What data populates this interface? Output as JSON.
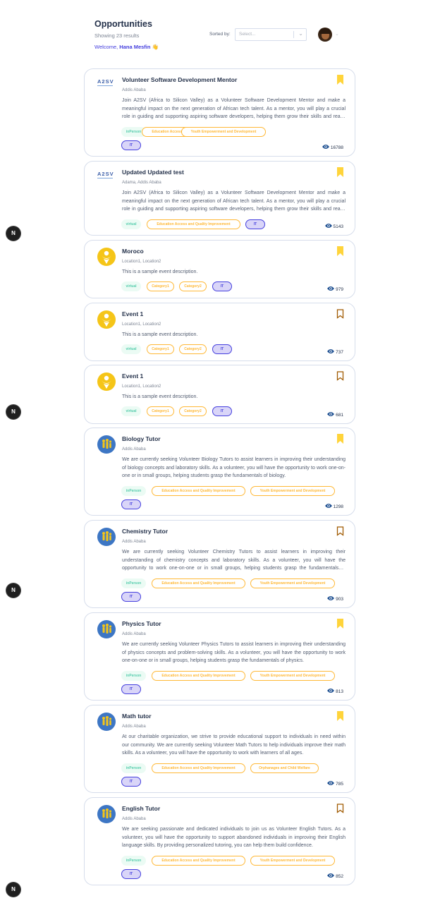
{
  "header": {
    "title": "Opportunities",
    "count": "Showing 23 results",
    "welcome_prefix": "Welcome, ",
    "user_name": "Hana Mesfin",
    "wave": "👋",
    "sort_label": "Sorted by:",
    "sort_placeholder": "Select..."
  },
  "colors": {
    "accent": "#4640de",
    "bookmark": "#ffd43b",
    "bookmark_outline": "#a05a00",
    "eye": "#1d4f91"
  },
  "cards": [
    {
      "logo": "A2SV",
      "title": "Volunteer Software Development Mentor",
      "location": "Addis Ababa",
      "description": "Join A2SV (Africa to Silicon Valley) as a Volunteer Software Development Mentor and make a meaningful impact on the next generation of African tech talent. As a mentor, you will play a crucial role in guiding and supporting aspiring software developers, helping them grow their skills and reach their potential.",
      "mode": "inPerson",
      "categories": [
        "Education Access and Quality Improvement",
        "Youth Empowerment and Development"
      ],
      "it": "IT",
      "views": "16788",
      "bookmarked": true
    },
    {
      "logo": "A2SV",
      "title": "Updated Updated test",
      "location": "Adama, Addis Ababa",
      "description": "Join A2SV (Africa to Silicon Valley) as a Volunteer Software Development Mentor and make a meaningful impact on the next generation of African tech talent. As a mentor, you will play a crucial role in guiding and supporting aspiring software developers, helping them grow their skills and reach their potential.",
      "mode": "virtual",
      "categories": [
        "Education Access and Quality Improvement"
      ],
      "it": "IT",
      "views": "5143",
      "bookmarked": true
    },
    {
      "logo": "event",
      "title": "Moroco",
      "location": "Location1, Location2",
      "description": "This is a sample event description.",
      "mode": "virtual",
      "categories": [
        "Category1",
        "Category2"
      ],
      "it": "IT",
      "views": "979",
      "bookmarked": true
    },
    {
      "logo": "event",
      "title": "Event 1",
      "location": "Location1, Location2",
      "description": "This is a sample event description.",
      "mode": "virtual",
      "categories": [
        "Category1",
        "Category2"
      ],
      "it": "IT",
      "views": "737",
      "bookmarked": false
    },
    {
      "logo": "event",
      "title": "Event 1",
      "location": "Location1, Location2",
      "description": "This is a sample event description.",
      "mode": "virtual",
      "categories": [
        "Category1",
        "Category2"
      ],
      "it": "IT",
      "views": "681",
      "bookmarked": false
    },
    {
      "logo": "tutor",
      "title": "Biology Tutor",
      "location": "Addis Ababa",
      "description": "We are currently seeking Volunteer Biology Tutors to assist learners in improving their understanding of biology concepts and laboratory skills. As a volunteer, you will have the opportunity to work one-on-one or in small groups, helping students grasp the fundamentals of biology.",
      "mode": "inPerson",
      "categories": [
        "Education Access and Quality Improvement",
        "Youth Empowerment and Development"
      ],
      "it": "IT",
      "views": "1298",
      "bookmarked": true
    },
    {
      "logo": "tutor",
      "title": "Chemistry Tutor",
      "location": "Addis Ababa",
      "description": "We are currently seeking Volunteer Chemistry Tutors to assist learners in improving their understanding of chemistry concepts and laboratory skills. As a volunteer, you will have the opportunity to work one-on-one or in small groups, helping students grasp the fundamentals of chemistry.",
      "mode": "inPerson",
      "categories": [
        "Education Access and Quality Improvement",
        "Youth Empowerment and Development"
      ],
      "it": "IT",
      "views": "903",
      "bookmarked": false
    },
    {
      "logo": "tutor",
      "title": "Physics Tutor",
      "location": "Addis Ababa",
      "description": "We are currently seeking Volunteer Physics Tutors to assist learners in improving their understanding of physics concepts and problem-solving skills. As a volunteer, you will have the opportunity to work one-on-one or in small groups, helping students grasp the fundamentals of physics.",
      "mode": "inPerson",
      "categories": [
        "Education Access and Quality Improvement",
        "Youth Empowerment and Development"
      ],
      "it": "IT",
      "views": "813",
      "bookmarked": true
    },
    {
      "logo": "tutor",
      "title": "Math tutor",
      "location": "Addis Ababa",
      "description": "At our charitable organization, we strive to provide educational support to individuals in need within our community. We are currently seeking Volunteer Math Tutors to help individuals improve their math skills. As a volunteer, you will have the opportunity to work with learners of all ages.",
      "mode": "inPerson",
      "categories": [
        "Education Access and Quality Improvement",
        "Orphanages and Child Welfare"
      ],
      "it": "IT",
      "views": "785",
      "bookmarked": true
    },
    {
      "logo": "tutor",
      "title": "English Tutor",
      "location": "Addis Ababa",
      "description": "We are seeking passionate and dedicated individuals to join us as Volunteer English Tutors. As a volunteer, you will have the opportunity to support abandoned individuals in improving their English language skills. By providing personalized tutoring, you can help them build confidence.",
      "mode": "inPerson",
      "categories": [
        "Education Access and Quality Improvement",
        "Youth Empowerment and Development"
      ],
      "it": "IT",
      "views": "852",
      "bookmarked": false
    }
  ],
  "dev_badges": [
    "N",
    "N",
    "N",
    "N"
  ]
}
